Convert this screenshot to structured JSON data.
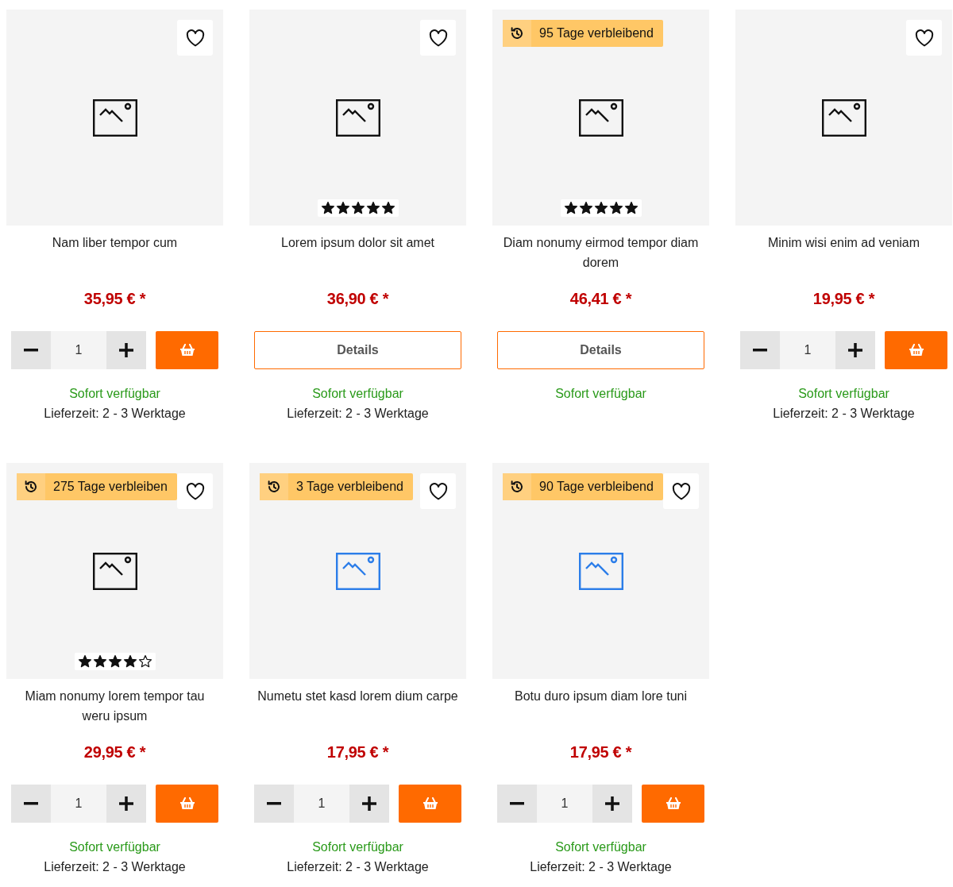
{
  "products": [
    {
      "title": "Nam liber tempor cum",
      "wishlist": true,
      "image": {
        "highlighted": false
      },
      "price": "35,95 € *",
      "purchase": {
        "kind": "quantity",
        "quantity": "1"
      },
      "availability": "Sofort verfügbar",
      "delivery": "Lieferzeit: 2 - 3 Werktage"
    },
    {
      "title": "Lorem ipsum dolor sit amet",
      "wishlist": true,
      "image": {
        "highlighted": false
      },
      "stars": 5,
      "price": "36,90 € *",
      "purchase": {
        "kind": "details",
        "label": "Details"
      },
      "availability": "Sofort verfügbar",
      "delivery": "Lieferzeit: 2 - 3 Werktage"
    },
    {
      "title": "Diam nonumy eirmod tempor diam dorem",
      "wishlist": false,
      "badge": "95 Tage verbleibend",
      "image": {
        "highlighted": false
      },
      "stars": 5,
      "price": "46,41 € *",
      "purchase": {
        "kind": "details",
        "label": "Details"
      },
      "availability": "Sofort verfügbar"
    },
    {
      "title": "Minim wisi enim ad veniam",
      "wishlist": true,
      "image": {
        "highlighted": false
      },
      "price": "19,95 € *",
      "purchase": {
        "kind": "quantity",
        "quantity": "1"
      },
      "availability": "Sofort verfügbar",
      "delivery": "Lieferzeit: 2 - 3 Werktage"
    },
    {
      "title": "Miam nonumy lorem tempor tau weru ipsum",
      "wishlist": true,
      "badge": "275 Tage verbleiben",
      "image": {
        "highlighted": false
      },
      "stars": 4,
      "price": "29,95 € *",
      "purchase": {
        "kind": "quantity",
        "quantity": "1"
      },
      "availability": "Sofort verfügbar",
      "delivery": "Lieferzeit: 2 - 3 Werktage"
    },
    {
      "title": "Numetu stet kasd lorem dium carpe",
      "wishlist": true,
      "badge": "3 Tage verbleibend",
      "image": {
        "highlighted": true
      },
      "price": "17,95 € *",
      "purchase": {
        "kind": "quantity",
        "quantity": "1"
      },
      "availability": "Sofort verfügbar",
      "delivery": "Lieferzeit: 2 - 3 Werktage"
    },
    {
      "title": "Botu duro ipsum diam lore tuni",
      "wishlist": true,
      "badge": "90 Tage verbleibend",
      "image": {
        "highlighted": true
      },
      "price": "17,95 € *",
      "purchase": {
        "kind": "quantity",
        "quantity": "1"
      },
      "availability": "Sofort verfügbar",
      "delivery": "Lieferzeit: 2 - 3 Werktage"
    }
  ]
}
